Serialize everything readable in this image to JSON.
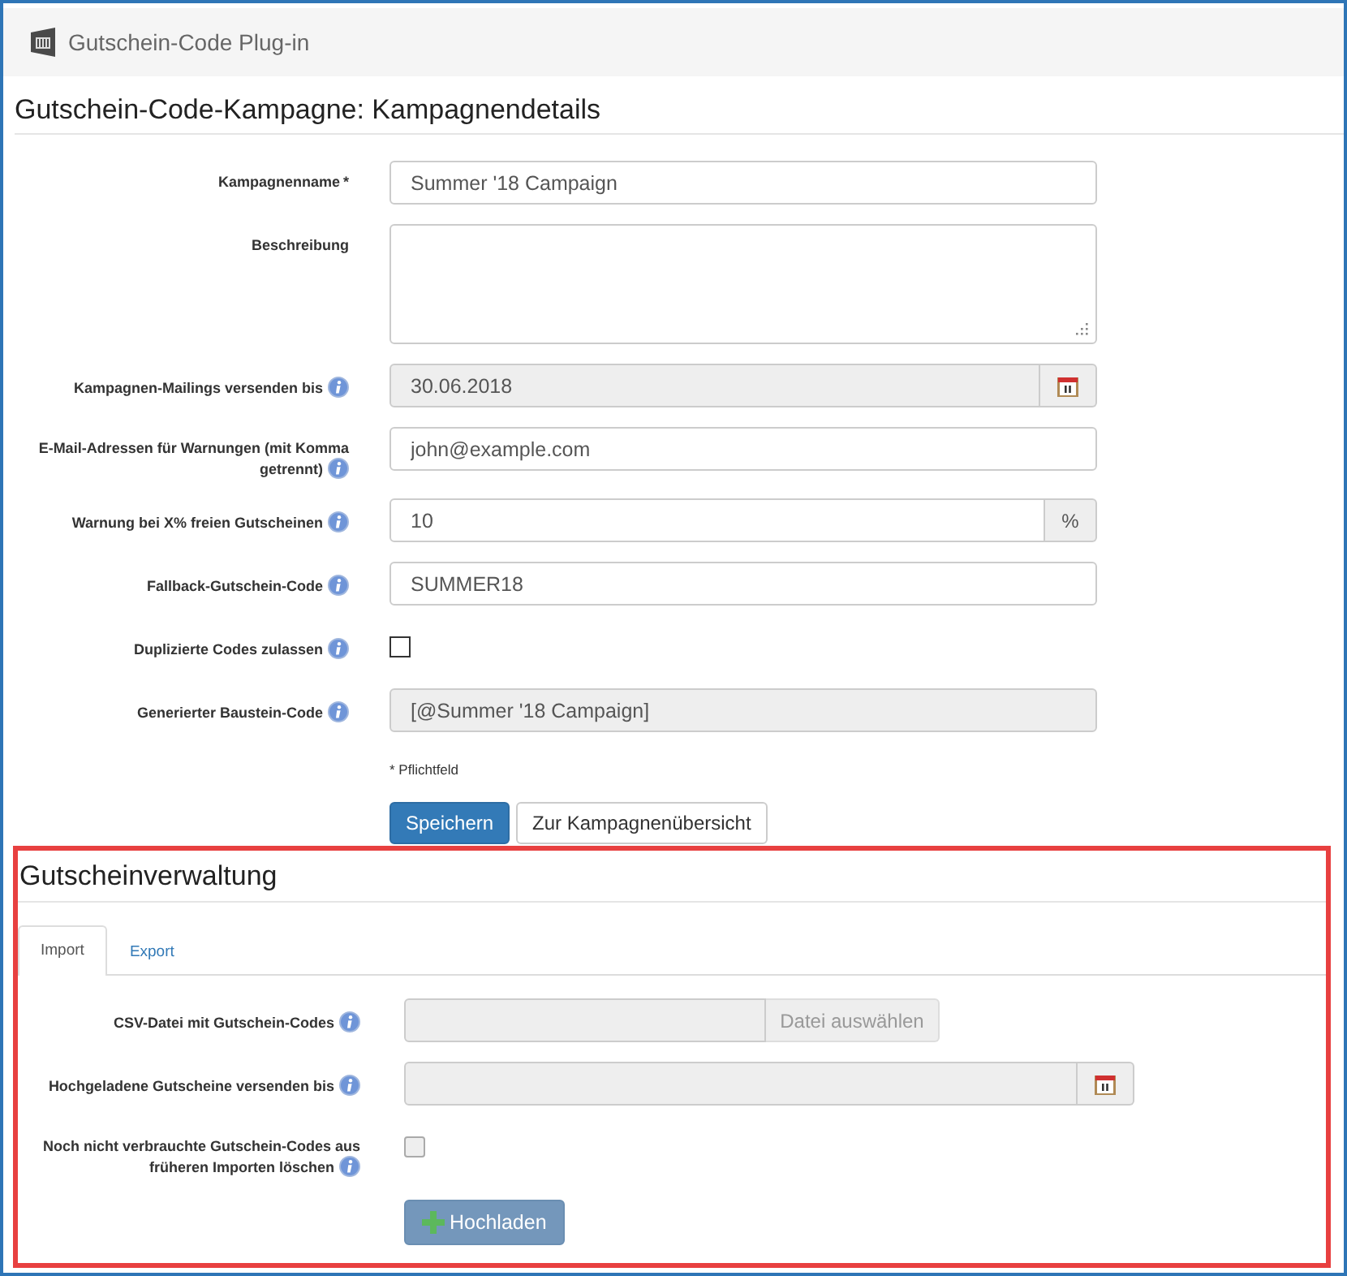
{
  "header": {
    "title": "Gutschein-Code Plug-in"
  },
  "page_title": "Gutschein-Code-Kampagne: Kampagnendetails",
  "campaign_form": {
    "fields": [
      {
        "kind": "text",
        "label": "Kampagnenname",
        "required_mark": "*",
        "info": false,
        "value": "Summer '18 Campaign",
        "disabled": false
      },
      {
        "kind": "textarea",
        "label": "Beschreibung",
        "info": false,
        "disabled": false
      },
      {
        "kind": "date",
        "label": "Kampagnen-Mailings versenden bis",
        "info": true,
        "value": "30.06.2018",
        "disabled": true
      },
      {
        "kind": "text",
        "label": "E-Mail-Adressen für Warnungen (mit Komma getrennt)",
        "info": true,
        "value": "john@example.com",
        "disabled": false
      },
      {
        "kind": "text",
        "label": "Warnung bei X% freien Gutscheinen",
        "info": true,
        "value": "10",
        "addon": "%",
        "disabled": false
      },
      {
        "kind": "text",
        "label": "Fallback-Gutschein-Code",
        "info": true,
        "value": "SUMMER18",
        "disabled": false
      },
      {
        "kind": "checkbox",
        "label": "Duplizierte Codes zulassen",
        "info": true,
        "checked": false,
        "disabled": false
      },
      {
        "kind": "text",
        "label": "Generierter Baustein-Code",
        "info": true,
        "value": "[@Summer '18 Campaign]",
        "disabled": true
      }
    ],
    "required_note": "* Pflichtfeld",
    "buttons": [
      {
        "label": "Speichern",
        "primary": true
      },
      {
        "label": "Zur Kampagnenübersicht",
        "primary": false
      }
    ]
  },
  "voucher_section": {
    "title": "Gutscheinverwaltung",
    "tabs": [
      {
        "label": "Import",
        "selected": true
      },
      {
        "label": "Export",
        "selected": false
      }
    ],
    "fields": [
      {
        "kind": "file",
        "label": "CSV-Datei mit Gutschein-Codes",
        "info": true,
        "button": "Datei auswählen",
        "disabled": true
      },
      {
        "kind": "date",
        "label": "Hochgeladene Gutscheine versenden bis",
        "info": true,
        "disabled": true
      },
      {
        "kind": "checkbox",
        "label": "Noch nicht verbrauchte Gutschein-Codes aus früheren Importen löschen",
        "info": true,
        "checked": false,
        "disabled": true
      }
    ],
    "upload_button": {
      "label": "Hochladen",
      "disabled": true
    }
  }
}
